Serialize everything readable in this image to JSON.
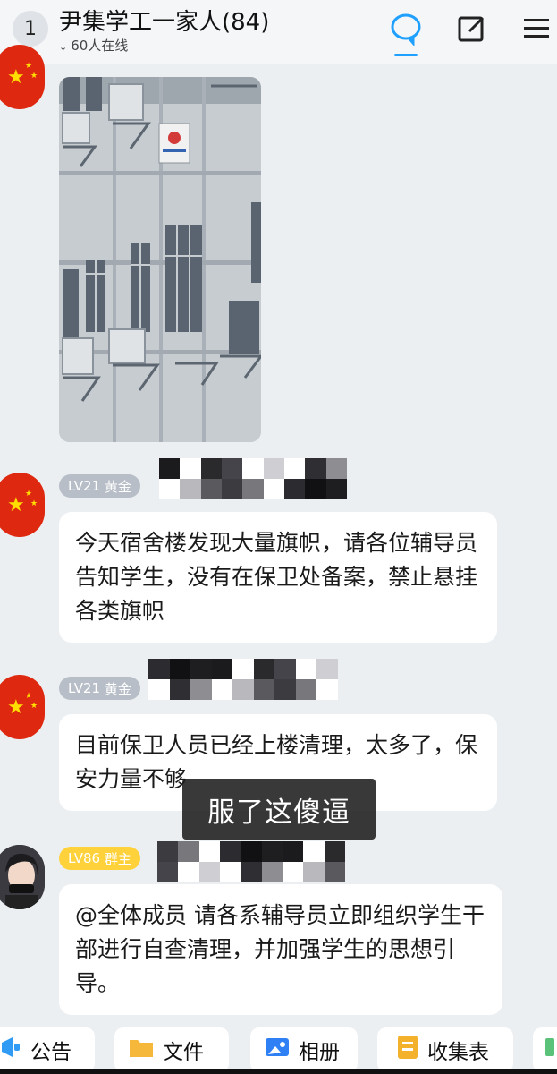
{
  "header": {
    "back_badge": "1",
    "title": "尹集学工一家人(84)",
    "online": "60人在线",
    "icons": [
      "chat-bubble-icon",
      "edit-icon",
      "menu-icon"
    ],
    "accent": "#1fa0ff"
  },
  "messages": [
    {
      "type": "image",
      "avatar": "china-flag-avatar"
    },
    {
      "type": "text",
      "level": "LV21",
      "title": "黄金",
      "name_redacted": true,
      "text": "今天宿舍楼发现大量旗帜，请各位辅导员告知学生，没有在保卫处备案，禁止悬挂各类旗帜"
    },
    {
      "type": "text",
      "level": "LV21",
      "title": "黄金",
      "name_redacted": true,
      "text": "目前保卫人员已经上楼清理，太多了，保安力量不够"
    },
    {
      "type": "text",
      "level": "LV86",
      "title": "群主",
      "name_redacted": true,
      "text": "@全体成员 请各系辅导员立即组织学生干部进行自查清理，并加强学生的思想引导。"
    }
  ],
  "overlay_caption": "服了这傻逼",
  "bottom_tabs": [
    {
      "label": "公告",
      "icon": "announcement-icon",
      "color": "#2f9bf5"
    },
    {
      "label": "文件",
      "icon": "folder-icon",
      "color": "#f6b83a"
    },
    {
      "label": "相册",
      "icon": "album-icon",
      "color": "#2f7ff5"
    },
    {
      "label": "收集表",
      "icon": "form-icon",
      "color": "#f3b12c"
    }
  ]
}
